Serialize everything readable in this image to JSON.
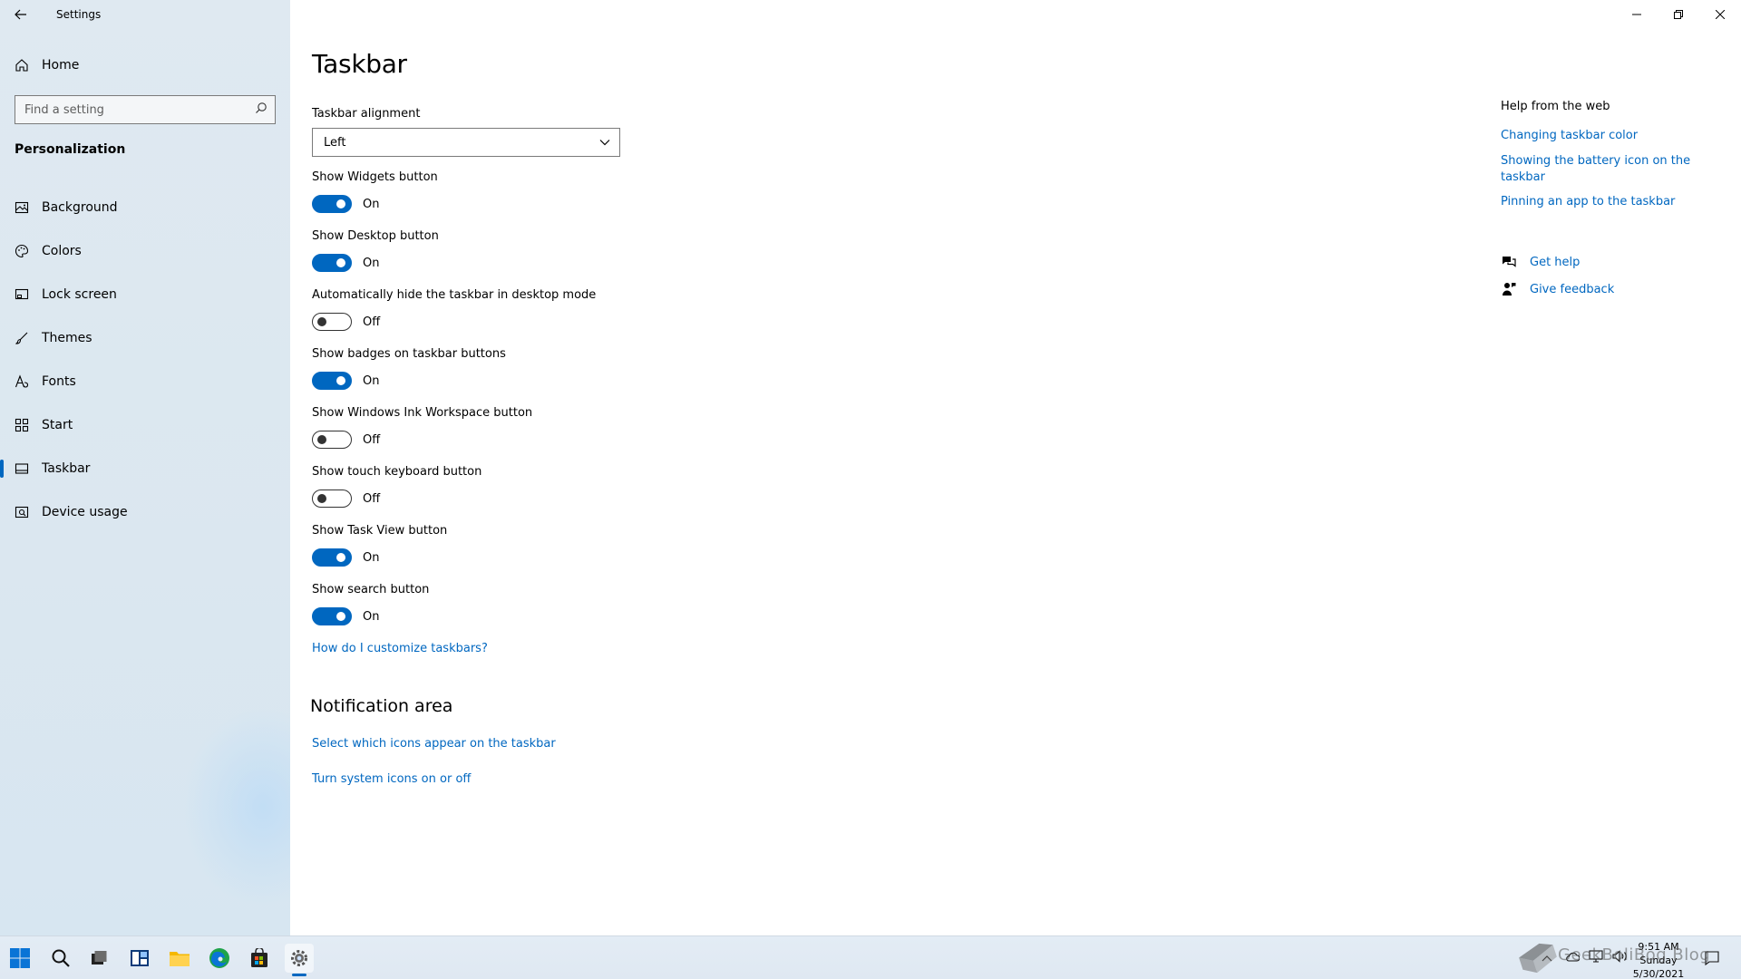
{
  "window": {
    "title": "Settings"
  },
  "sidebar": {
    "home_label": "Home",
    "search_placeholder": "Find a setting",
    "section_title": "Personalization",
    "items": [
      {
        "label": "Background",
        "icon": "image-icon"
      },
      {
        "label": "Colors",
        "icon": "palette-icon"
      },
      {
        "label": "Lock screen",
        "icon": "lock-screen-icon"
      },
      {
        "label": "Themes",
        "icon": "brush-icon"
      },
      {
        "label": "Fonts",
        "icon": "font-icon"
      },
      {
        "label": "Start",
        "icon": "start-grid-icon"
      },
      {
        "label": "Taskbar",
        "icon": "taskbar-icon",
        "active": true
      },
      {
        "label": "Device usage",
        "icon": "device-usage-icon"
      }
    ]
  },
  "main": {
    "title": "Taskbar",
    "alignment": {
      "label": "Taskbar alignment",
      "value": "Left"
    },
    "toggles": [
      {
        "label": "Show Widgets button",
        "state": "On"
      },
      {
        "label": "Show Desktop button",
        "state": "On"
      },
      {
        "label": "Automatically hide the taskbar in desktop mode",
        "state": "Off"
      },
      {
        "label": "Show badges on taskbar buttons",
        "state": "On"
      },
      {
        "label": "Show Windows Ink Workspace button",
        "state": "Off"
      },
      {
        "label": "Show touch keyboard button",
        "state": "Off"
      },
      {
        "label": "Show Task View button",
        "state": "On"
      },
      {
        "label": "Show search button",
        "state": "On"
      }
    ],
    "customize_link": "How do I customize taskbars?",
    "notification_area": {
      "title": "Notification area",
      "links": [
        "Select which icons appear on the taskbar",
        "Turn system icons on or off"
      ]
    }
  },
  "help": {
    "title": "Help from the web",
    "links": [
      "Changing taskbar color",
      "Showing the battery icon on the taskbar",
      "Pinning an app to the taskbar"
    ],
    "get_help": "Get help",
    "give_feedback": "Give feedback"
  },
  "taskbar": {
    "time": "9:51 AM",
    "day": "Sunday",
    "date": "5/30/2021",
    "watermark": "GeekBoliBog Blog",
    "colors": {
      "accent": "#0067c0"
    }
  }
}
